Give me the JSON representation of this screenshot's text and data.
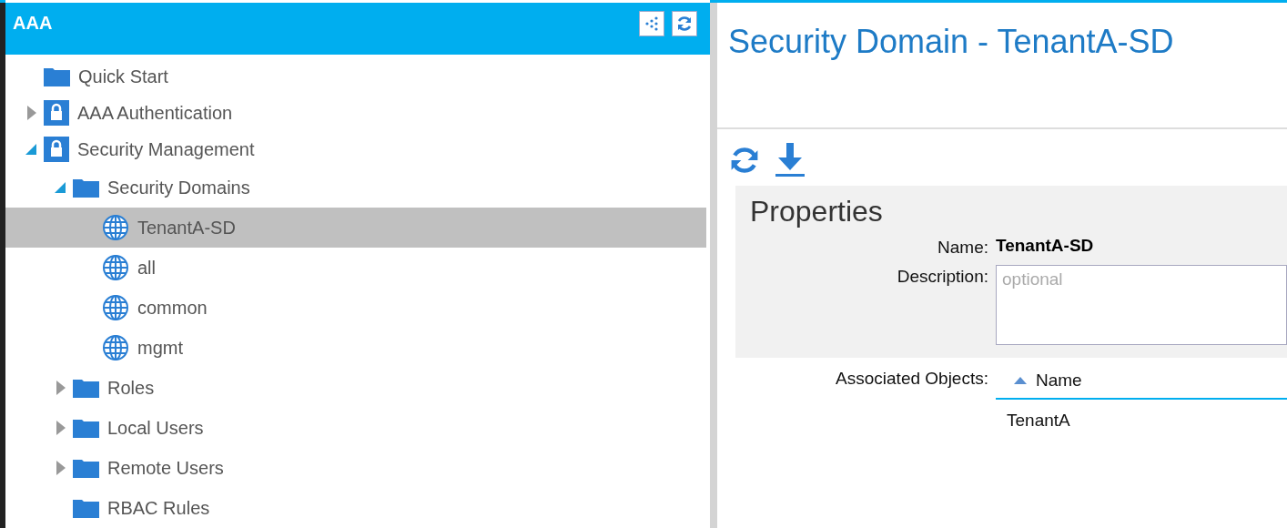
{
  "sidebar": {
    "title": "AAA",
    "tree": [
      {
        "label": "Quick Start",
        "kind": "folder",
        "selected": false
      },
      {
        "label": "AAA Authentication",
        "kind": "lock",
        "expanded": false,
        "selected": false
      },
      {
        "label": "Security Management",
        "kind": "lock",
        "expanded": true,
        "selected": false,
        "children": [
          {
            "label": "Security Domains",
            "kind": "folder",
            "expanded": true,
            "selected": false,
            "children": [
              {
                "label": "TenantA-SD",
                "kind": "globe",
                "selected": true
              },
              {
                "label": "all",
                "kind": "globe",
                "selected": false
              },
              {
                "label": "common",
                "kind": "globe",
                "selected": false
              },
              {
                "label": "mgmt",
                "kind": "globe",
                "selected": false
              }
            ]
          },
          {
            "label": "Roles",
            "kind": "folder",
            "expanded": false,
            "selected": false
          },
          {
            "label": "Local Users",
            "kind": "folder",
            "expanded": false,
            "selected": false
          },
          {
            "label": "Remote Users",
            "kind": "folder",
            "expanded": false,
            "selected": false
          },
          {
            "label": "RBAC Rules",
            "kind": "folder",
            "selected": false
          }
        ]
      }
    ]
  },
  "detail": {
    "title": "Security Domain - TenantA-SD",
    "properties": {
      "heading": "Properties",
      "name_label": "Name:",
      "name_value": "TenantA-SD",
      "description_label": "Description:",
      "description_placeholder": "optional"
    },
    "associated": {
      "label": "Associated Objects:",
      "column": "Name",
      "rows": [
        "TenantA"
      ]
    }
  }
}
